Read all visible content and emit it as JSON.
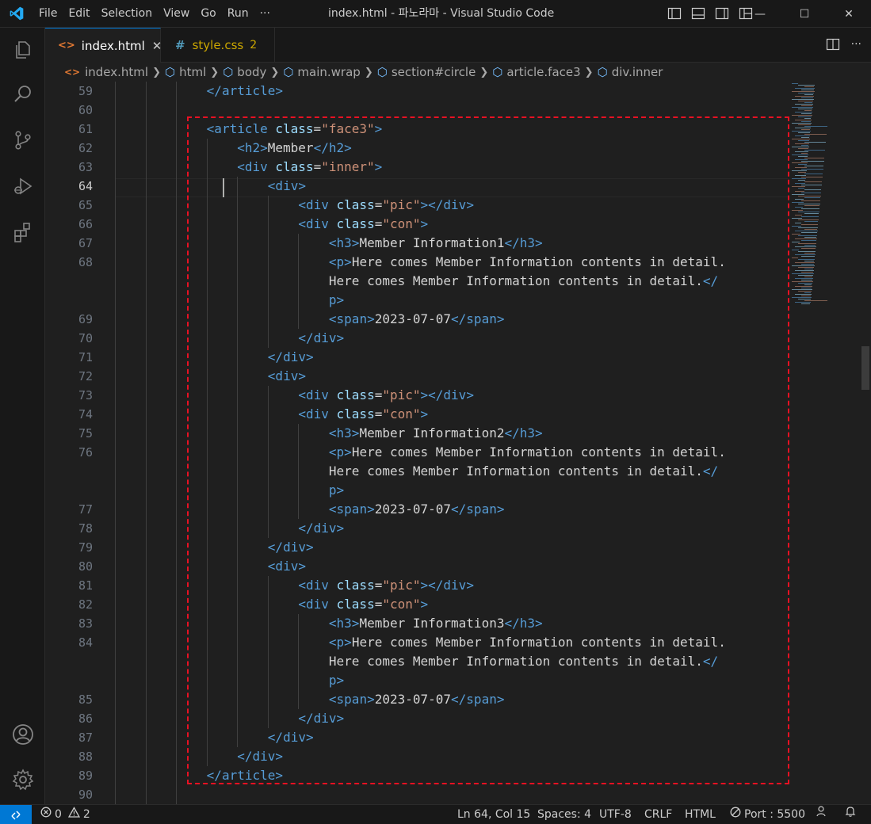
{
  "titlebar": {
    "menu": [
      "File",
      "Edit",
      "Selection",
      "View",
      "Go",
      "Run",
      "···"
    ],
    "title": "index.html - 파노라마 - Visual Studio Code",
    "controls": [
      "—",
      "☐",
      "✕"
    ]
  },
  "tabs": [
    {
      "icon": "<>",
      "label": "index.html",
      "close": "✕"
    },
    {
      "icon": "#",
      "label": "style.css",
      "badge": "2"
    }
  ],
  "breadcrumb": [
    "index.html",
    "html",
    "body",
    "main.wrap",
    "section#circle",
    "article.face3",
    "div.inner"
  ],
  "editor": {
    "current_line": 64,
    "lines": [
      {
        "n": "59",
        "indent": 3,
        "tokens": [
          [
            "tag",
            "</article>"
          ]
        ]
      },
      {
        "n": "60",
        "indent": 0,
        "tokens": []
      },
      {
        "n": "61",
        "indent": 3,
        "tokens": [
          [
            "tag",
            "<article "
          ],
          [
            "attr",
            "class"
          ],
          [
            "txt",
            "="
          ],
          [
            "str",
            "\"face3\""
          ],
          [
            "tag",
            ">"
          ]
        ]
      },
      {
        "n": "62",
        "indent": 4,
        "tokens": [
          [
            "tag",
            "<h2>"
          ],
          [
            "txt",
            "Member"
          ],
          [
            "tag",
            "</h2>"
          ]
        ]
      },
      {
        "n": "63",
        "indent": 4,
        "tokens": [
          [
            "tag",
            "<div "
          ],
          [
            "attr",
            "class"
          ],
          [
            "txt",
            "="
          ],
          [
            "str",
            "\"inner\""
          ],
          [
            "tag",
            ">"
          ]
        ]
      },
      {
        "n": "64",
        "indent": 5,
        "tokens": [
          [
            "tag",
            "<div>"
          ]
        ]
      },
      {
        "n": "65",
        "indent": 6,
        "tokens": [
          [
            "tag",
            "<div "
          ],
          [
            "attr",
            "class"
          ],
          [
            "txt",
            "="
          ],
          [
            "str",
            "\"pic\""
          ],
          [
            "tag",
            "></div>"
          ]
        ]
      },
      {
        "n": "66",
        "indent": 6,
        "tokens": [
          [
            "tag",
            "<div "
          ],
          [
            "attr",
            "class"
          ],
          [
            "txt",
            "="
          ],
          [
            "str",
            "\"con\""
          ],
          [
            "tag",
            ">"
          ]
        ]
      },
      {
        "n": "67",
        "indent": 7,
        "tokens": [
          [
            "tag",
            "<h3>"
          ],
          [
            "txt",
            "Member Information1"
          ],
          [
            "tag",
            "</h3>"
          ]
        ]
      },
      {
        "n": "68",
        "indent": 7,
        "tokens": [
          [
            "tag",
            "<p>"
          ],
          [
            "txt",
            "Here comes Member Information contents in detail."
          ]
        ]
      },
      {
        "n": "",
        "indent": 7,
        "tokens": [
          [
            "txt",
            "Here comes Member Information contents in detail."
          ],
          [
            "tag",
            "</"
          ]
        ]
      },
      {
        "n": "",
        "indent": 7,
        "tokens": [
          [
            "tag",
            "p>"
          ]
        ]
      },
      {
        "n": "69",
        "indent": 7,
        "tokens": [
          [
            "tag",
            "<span>"
          ],
          [
            "txt",
            "2023-07-07"
          ],
          [
            "tag",
            "</span>"
          ]
        ]
      },
      {
        "n": "70",
        "indent": 6,
        "tokens": [
          [
            "tag",
            "</div>"
          ]
        ]
      },
      {
        "n": "71",
        "indent": 5,
        "tokens": [
          [
            "tag",
            "</div>"
          ]
        ]
      },
      {
        "n": "72",
        "indent": 5,
        "tokens": [
          [
            "tag",
            "<div>"
          ]
        ]
      },
      {
        "n": "73",
        "indent": 6,
        "tokens": [
          [
            "tag",
            "<div "
          ],
          [
            "attr",
            "class"
          ],
          [
            "txt",
            "="
          ],
          [
            "str",
            "\"pic\""
          ],
          [
            "tag",
            "></div>"
          ]
        ]
      },
      {
        "n": "74",
        "indent": 6,
        "tokens": [
          [
            "tag",
            "<div "
          ],
          [
            "attr",
            "class"
          ],
          [
            "txt",
            "="
          ],
          [
            "str",
            "\"con\""
          ],
          [
            "tag",
            ">"
          ]
        ]
      },
      {
        "n": "75",
        "indent": 7,
        "tokens": [
          [
            "tag",
            "<h3>"
          ],
          [
            "txt",
            "Member Information2"
          ],
          [
            "tag",
            "</h3>"
          ]
        ]
      },
      {
        "n": "76",
        "indent": 7,
        "tokens": [
          [
            "tag",
            "<p>"
          ],
          [
            "txt",
            "Here comes Member Information contents in detail."
          ]
        ]
      },
      {
        "n": "",
        "indent": 7,
        "tokens": [
          [
            "txt",
            "Here comes Member Information contents in detail."
          ],
          [
            "tag",
            "</"
          ]
        ]
      },
      {
        "n": "",
        "indent": 7,
        "tokens": [
          [
            "tag",
            "p>"
          ]
        ]
      },
      {
        "n": "77",
        "indent": 7,
        "tokens": [
          [
            "tag",
            "<span>"
          ],
          [
            "txt",
            "2023-07-07"
          ],
          [
            "tag",
            "</span>"
          ]
        ]
      },
      {
        "n": "78",
        "indent": 6,
        "tokens": [
          [
            "tag",
            "</div>"
          ]
        ]
      },
      {
        "n": "79",
        "indent": 5,
        "tokens": [
          [
            "tag",
            "</div>"
          ]
        ]
      },
      {
        "n": "80",
        "indent": 5,
        "tokens": [
          [
            "tag",
            "<div>"
          ]
        ]
      },
      {
        "n": "81",
        "indent": 6,
        "tokens": [
          [
            "tag",
            "<div "
          ],
          [
            "attr",
            "class"
          ],
          [
            "txt",
            "="
          ],
          [
            "str",
            "\"pic\""
          ],
          [
            "tag",
            "></div>"
          ]
        ]
      },
      {
        "n": "82",
        "indent": 6,
        "tokens": [
          [
            "tag",
            "<div "
          ],
          [
            "attr",
            "class"
          ],
          [
            "txt",
            "="
          ],
          [
            "str",
            "\"con\""
          ],
          [
            "tag",
            ">"
          ]
        ]
      },
      {
        "n": "83",
        "indent": 7,
        "tokens": [
          [
            "tag",
            "<h3>"
          ],
          [
            "txt",
            "Member Information3"
          ],
          [
            "tag",
            "</h3>"
          ]
        ]
      },
      {
        "n": "84",
        "indent": 7,
        "tokens": [
          [
            "tag",
            "<p>"
          ],
          [
            "txt",
            "Here comes Member Information contents in detail."
          ]
        ]
      },
      {
        "n": "",
        "indent": 7,
        "tokens": [
          [
            "txt",
            "Here comes Member Information contents in detail."
          ],
          [
            "tag",
            "</"
          ]
        ]
      },
      {
        "n": "",
        "indent": 7,
        "tokens": [
          [
            "tag",
            "p>"
          ]
        ]
      },
      {
        "n": "85",
        "indent": 7,
        "tokens": [
          [
            "tag",
            "<span>"
          ],
          [
            "txt",
            "2023-07-07"
          ],
          [
            "tag",
            "</span>"
          ]
        ]
      },
      {
        "n": "86",
        "indent": 6,
        "tokens": [
          [
            "tag",
            "</div>"
          ]
        ]
      },
      {
        "n": "87",
        "indent": 5,
        "tokens": [
          [
            "tag",
            "</div>"
          ]
        ]
      },
      {
        "n": "88",
        "indent": 4,
        "tokens": [
          [
            "tag",
            "</div>"
          ]
        ]
      },
      {
        "n": "89",
        "indent": 3,
        "tokens": [
          [
            "tag",
            "</article>"
          ]
        ]
      },
      {
        "n": "90",
        "indent": 0,
        "tokens": []
      }
    ]
  },
  "statusbar": {
    "errors": "0",
    "warnings": "2",
    "position": "Ln 64, Col 15",
    "spaces": "Spaces: 4",
    "encoding": "UTF-8",
    "eol": "CRLF",
    "language": "HTML",
    "port": "Port : 5500"
  },
  "colors": {
    "accent": "#0078d4",
    "highlight_border": "#e81123",
    "tag": "#569cd6",
    "attr": "#9cdcfe",
    "string": "#ce9178",
    "html_icon": "#e37933",
    "css_icon": "#519aba",
    "css_tab_text": "#cca700"
  }
}
